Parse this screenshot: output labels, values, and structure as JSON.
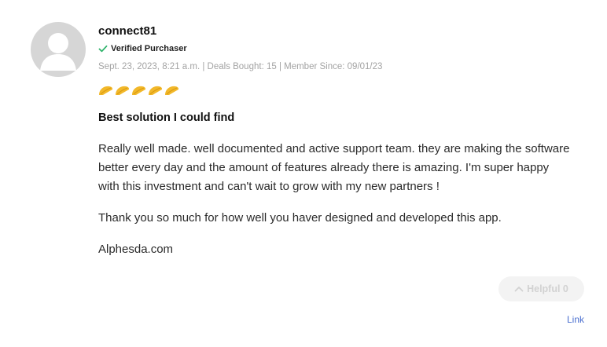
{
  "review": {
    "username": "connect81",
    "verified_label": "Verified Purchaser",
    "meta": "Sept. 23, 2023, 8:21 a.m. | Deals Bought: 15 | Member Since: 09/01/23",
    "rating": 5,
    "rating_max": 5,
    "rating_icon": "taco-icon",
    "title": "Best solution I could find",
    "paragraphs": [
      "Really well made. well documented and active support team. they are making the software better every day and the amount of features already there is amazing. I'm super happy with this investment and can't wait to grow with my new partners !",
      "Thank you so much for how well you haver designed and developed this app.",
      "Alphesda.com"
    ]
  },
  "actions": {
    "helpful_label": "Helpful 0",
    "link_label": "Link"
  },
  "colors": {
    "verified_check": "#2fb36b",
    "rating_taco": "#f2b82a",
    "link": "#4a6fcf",
    "meta_text": "#a3a3a3"
  }
}
